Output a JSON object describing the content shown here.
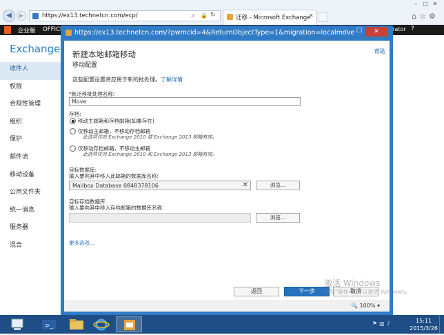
{
  "browser": {
    "url": "https://ex13.technetcn.com/ecp/",
    "tab_title": "迁移 - Microsoft Exchange",
    "accent": "#2f7bc5"
  },
  "o365bar": {
    "tenant": "企业版",
    "office": "OFFICE",
    "user": "trator",
    "help": "?"
  },
  "eac": {
    "title": "Exchange 管",
    "nav": [
      "收件人",
      "权限",
      "合规性管理",
      "组织",
      "保护",
      "邮件流",
      "移动设备",
      "公用文件夹",
      "统一消息",
      "服务器",
      "混合"
    ],
    "selected_index": 0
  },
  "dialog": {
    "url": "https://ex13.technetcn.com/?pwmcid=4&ReturnObjectType=1&migration=localmove",
    "help": "帮助",
    "heading": "新建本地邮箱移动",
    "subheading": "移动配置",
    "intro": "这些配置设置将应用于新的批处理。",
    "learn_more": "了解详情",
    "batch_name_label": "*新迁移批处理名称:",
    "batch_name_value": "Move",
    "move_label": "存档:",
    "options": [
      {
        "label": "移动主邮箱和存档邮箱(如果存在)",
        "note": "",
        "selected": true
      },
      {
        "label": "仅移动主邮箱，不移动存档邮箱",
        "note": "此选项仅对 Exchange 2010 或 Exchange 2013 邮箱有效。",
        "selected": false
      },
      {
        "label": "仅移动存档邮箱，不移动主邮箱",
        "note": "此选项仅对 Exchange 2010 和 Exchange 2013 邮箱有效。",
        "selected": false
      }
    ],
    "target_db_label": "目标数据库:",
    "target_db_hint": "输入要向其中移入此邮箱的数据库名称:",
    "target_db_value": "Mailbox Database 0848378106",
    "clear": "✕",
    "browse": "浏览...",
    "archive_db_label": "目标存档数据库:",
    "archive_db_hint": "输入要向其中移入存档邮箱的数据库名称:",
    "more_options": "更多选项...",
    "back": "返回",
    "next": "下一步",
    "cancel": "取消",
    "zoom": "100%"
  },
  "watermark": {
    "title": "激活 Windows",
    "sub": "转到\"操作中心\"以激活 Windows。"
  },
  "taskbar": {
    "time": "15:11",
    "date": "2015/3/26"
  }
}
